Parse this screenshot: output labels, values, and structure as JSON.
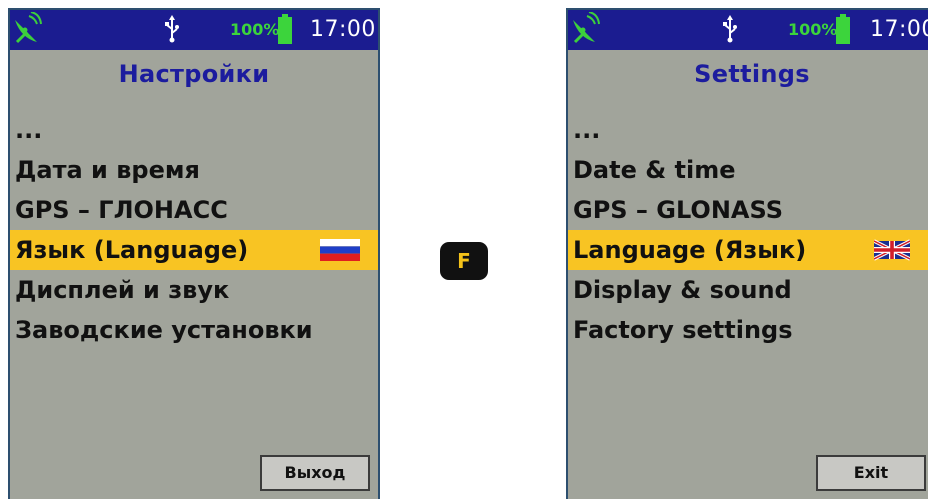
{
  "left_screen": {
    "status": {
      "battery_percent": "100%",
      "time": "17:00"
    },
    "title": "Настройки",
    "menu": [
      {
        "label": "..."
      },
      {
        "label": "Дата и время"
      },
      {
        "label": "GPS – ГЛОНАСС"
      },
      {
        "label": "Язык (Language)",
        "selected": true,
        "flag": "russia-flag"
      },
      {
        "label": "Дисплей и звук"
      },
      {
        "label": "Заводские установки"
      }
    ],
    "exit_label": "Выход"
  },
  "right_screen": {
    "status": {
      "battery_percent": "100%",
      "time": "17:00"
    },
    "title": "Settings",
    "menu": [
      {
        "label": "..."
      },
      {
        "label": "Date & time"
      },
      {
        "label": "GPS – GLONASS"
      },
      {
        "label": "Language (Язык)",
        "selected": true,
        "flag": "uk-flag"
      },
      {
        "label": "Display & sound"
      },
      {
        "label": "Factory settings"
      }
    ],
    "exit_label": "Exit"
  },
  "f_key": {
    "label": "F"
  },
  "colors": {
    "status_bar": "#1b1c90",
    "screen_background": "#a1a49b",
    "selection": "#f8c423",
    "title": "#1c1c9e",
    "battery_green": "#3cd43c",
    "key_background": "#111111",
    "key_text": "#f4c219"
  }
}
